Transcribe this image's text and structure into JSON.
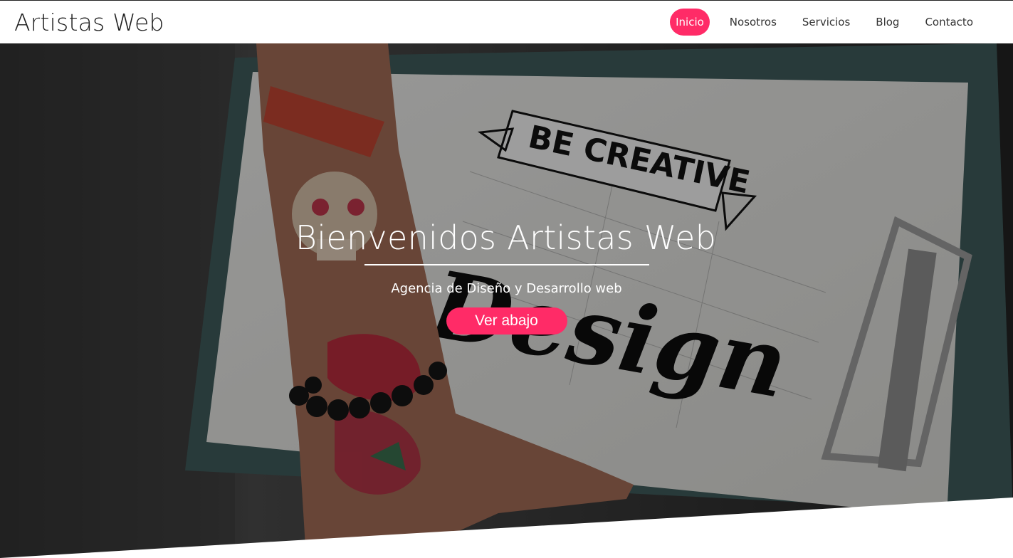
{
  "header": {
    "brand": "Artistas Web",
    "nav": [
      {
        "label": "Inicio",
        "active": true
      },
      {
        "label": "Nosotros",
        "active": false
      },
      {
        "label": "Servicios",
        "active": false
      },
      {
        "label": "Blog",
        "active": false
      },
      {
        "label": "Contacto",
        "active": false
      }
    ]
  },
  "hero": {
    "title": "Bienvenidos Artistas Web",
    "subtitle": "Agencia de Diseño y Desarrollo web",
    "button_label": "Ver abajo",
    "image": {
      "banner_text": "BE CREATIVE",
      "script_text": "Design"
    }
  },
  "colors": {
    "accent": "#ff2b67",
    "header_bg": "#ffffff",
    "text_dark": "#1f1f1f"
  }
}
